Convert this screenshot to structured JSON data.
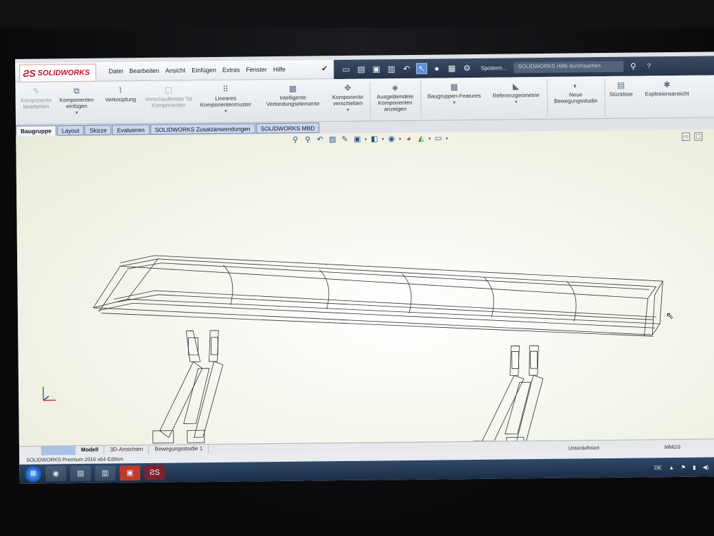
{
  "app": {
    "logo_mark": "ƧS",
    "logo_text": "SOLIDWORKS"
  },
  "menu": [
    "Datei",
    "Bearbeiten",
    "Ansicht",
    "Einfügen",
    "Extras",
    "Fenster",
    "Hilfe"
  ],
  "quick_access": {
    "document_name": "Spoilerm...",
    "search_placeholder": "SOLIDWORKS Hilfe durchsuchen",
    "help_label": "?"
  },
  "ribbon": {
    "komponente_bearbeiten": "Komponente bearbeiten",
    "komponenten_einfuegen": "Komponenten einfügen",
    "verknuepfung": "Verknüpfung",
    "vorschaufenster": "Vorschaufenster für Komponenten",
    "lineares_muster": "Lineares Komponentenmuster",
    "intelligente": "Intelligente Verbindungselemente",
    "verschieben": "Komponente verschieben",
    "ausgeblendete": "Ausgeblendete Komponenten anzeigen",
    "baugruppen_features": "Baugruppen-Features",
    "referenzgeometrie": "Referenzgeometrie",
    "bewegungsstudie": "Neue Bewegungsstudie",
    "stueckliste": "Stückliste",
    "explosionsansicht": "Explosionsansicht"
  },
  "tabs": [
    "Baugruppe",
    "Layout",
    "Skizze",
    "Evaluieren",
    "SOLIDWORKS Zusatzanwendungen",
    "SOLIDWORKS MBD"
  ],
  "model_tabs": [
    "Modell",
    "3D-Ansichten",
    "Bewegungsstudie 1"
  ],
  "status": {
    "edition": "SOLIDWORKS Premium 2016 x64-Edition",
    "definition": "Unterdefiniert",
    "units": "MMGS"
  },
  "taskbar": {
    "language": "DE"
  }
}
